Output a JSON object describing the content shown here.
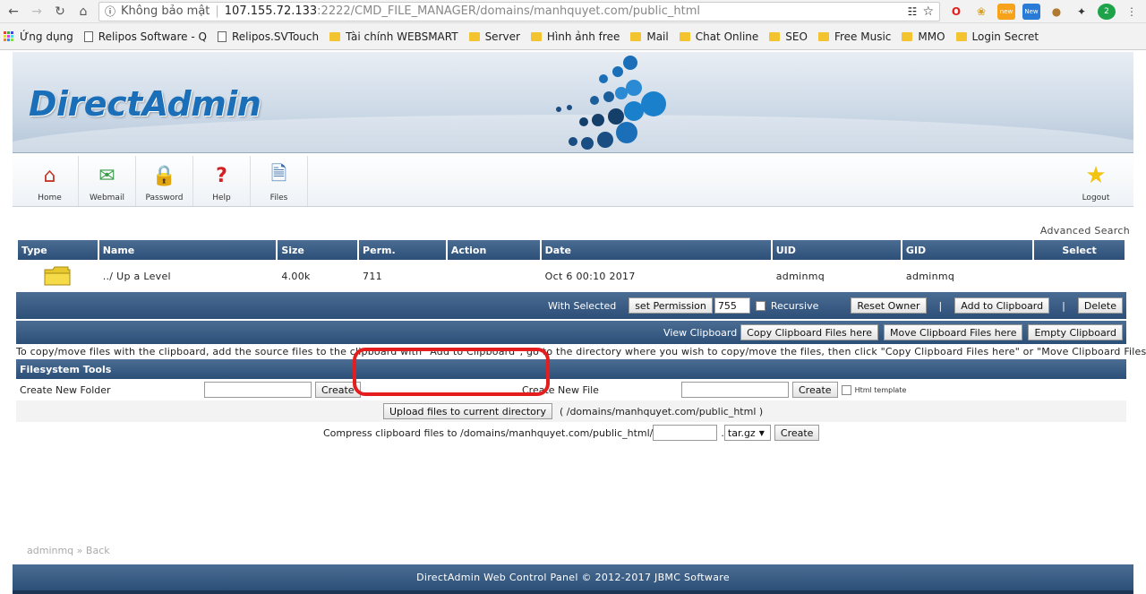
{
  "browser": {
    "security_label": "Không bảo mật",
    "url_host": "107.155.72.133",
    "url_path": ":2222/CMD_FILE_MANAGER/domains/manhquyet.com/public_html",
    "bookmarks": [
      {
        "label": "Ứng dụng",
        "icon": "apps-icon"
      },
      {
        "label": "Relipos Software - Q",
        "icon": "page-icon"
      },
      {
        "label": "Relipos.SVTouch",
        "icon": "page-icon"
      },
      {
        "label": "Tài chính WEBSMART",
        "icon": "folder-icon"
      },
      {
        "label": "Server",
        "icon": "folder-icon"
      },
      {
        "label": "Hình ảnh free",
        "icon": "folder-icon"
      },
      {
        "label": "Mail",
        "icon": "folder-icon"
      },
      {
        "label": "Chat Online",
        "icon": "folder-icon"
      },
      {
        "label": "SEO",
        "icon": "folder-icon"
      },
      {
        "label": "Free Music",
        "icon": "folder-icon"
      },
      {
        "label": "MMO",
        "icon": "folder-icon"
      },
      {
        "label": "Login Secret",
        "icon": "folder-icon"
      }
    ],
    "ext_badge_new1": "new",
    "ext_badge_new2": "New",
    "ext_badge_count": "2"
  },
  "banner": {
    "logo": "DirectAdmin"
  },
  "toolbar": {
    "home": "Home",
    "webmail": "Webmail",
    "password": "Password",
    "help": "Help",
    "files": "Files",
    "logout": "Logout"
  },
  "advanced_search": "Advanced Search",
  "table": {
    "headers": [
      "Type",
      "Name",
      "Size",
      "Perm.",
      "Action",
      "Date",
      "UID",
      "GID",
      "Select"
    ],
    "rows": [
      {
        "name": "../ Up a Level",
        "size": "4.00k",
        "perm": "711",
        "action": "",
        "date": "Oct 6 00:10 2017",
        "uid": "adminmq",
        "gid": "adminmq"
      }
    ]
  },
  "selected_bar": {
    "label": "With Selected",
    "set_permission": "set Permission",
    "permission_value": "755",
    "recursive": "Recursive",
    "reset_owner": "Reset Owner",
    "add_clipboard": "Add to Clipboard",
    "delete": "Delete",
    "pipe": "|"
  },
  "clipboard_bar": {
    "label": "View Clipboard",
    "copy": "Copy Clipboard Files here",
    "move": "Move Clipboard Files here",
    "empty": "Empty Clipboard"
  },
  "note": "To copy/move files with the clipboard, add the source files to the clipboard with \"Add to Clipboard\", go to the directory where you wish to copy/move the files, then click \"Copy Clipboard Files here\" or \"Move Clipboard Files here\"",
  "filesystem": {
    "title": "Filesystem Tools",
    "create_folder_label": "Create New Folder",
    "create_folder_btn": "Create",
    "create_file_label": "Create New File",
    "create_file_btn": "Create",
    "html_template": "Html template",
    "upload_btn": "Upload files to current directory",
    "upload_path": "( /domains/manhquyet.com/public_html )",
    "compress_label": "Compress clipboard files to /domains/manhquyet.com/public_html/",
    "compress_ext": "tar.gz",
    "compress_btn": "Create"
  },
  "crumbs": {
    "user": "adminmq",
    "sep": "»",
    "back": "Back"
  },
  "footer": "DirectAdmin Web Control Panel © 2012-2017 JBMC Software"
}
